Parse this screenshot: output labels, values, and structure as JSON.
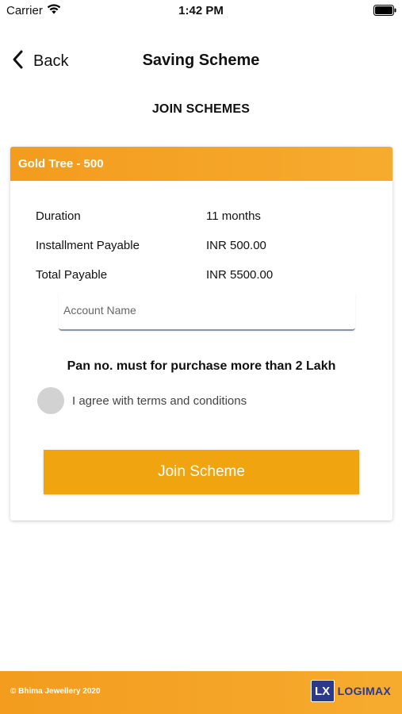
{
  "status_bar": {
    "carrier": "Carrier",
    "time": "1:42 PM",
    "wifi_icon": "wifi-icon",
    "battery_icon": "battery-icon"
  },
  "nav": {
    "back_label": "Back",
    "back_icon": "chevron-left-icon",
    "title": "Saving Scheme"
  },
  "section_title": "JOIN SCHEMES",
  "scheme_card": {
    "header": "Gold Tree - 500",
    "details": [
      {
        "label": "Duration",
        "value": "11 months"
      },
      {
        "label": "Installment Payable",
        "value": "INR 500.00"
      },
      {
        "label": "Total Payable",
        "value": "INR 5500.00"
      }
    ],
    "account_name": {
      "value": "",
      "placeholder": "Account Name"
    },
    "pan_note": "Pan no. must for purchase more than 2 Lakh",
    "agree_label": "I agree with terms and conditions",
    "agree_checked": false,
    "join_button": "Join Scheme"
  },
  "footer": {
    "copyright": "© Bhima Jewellery 2020",
    "logo_mark": "LX",
    "logo_text": "LOGIMAX"
  },
  "colors": {
    "accent": "#f39c1e",
    "button": "#f0a40f",
    "logo": "#2b3a8c"
  }
}
